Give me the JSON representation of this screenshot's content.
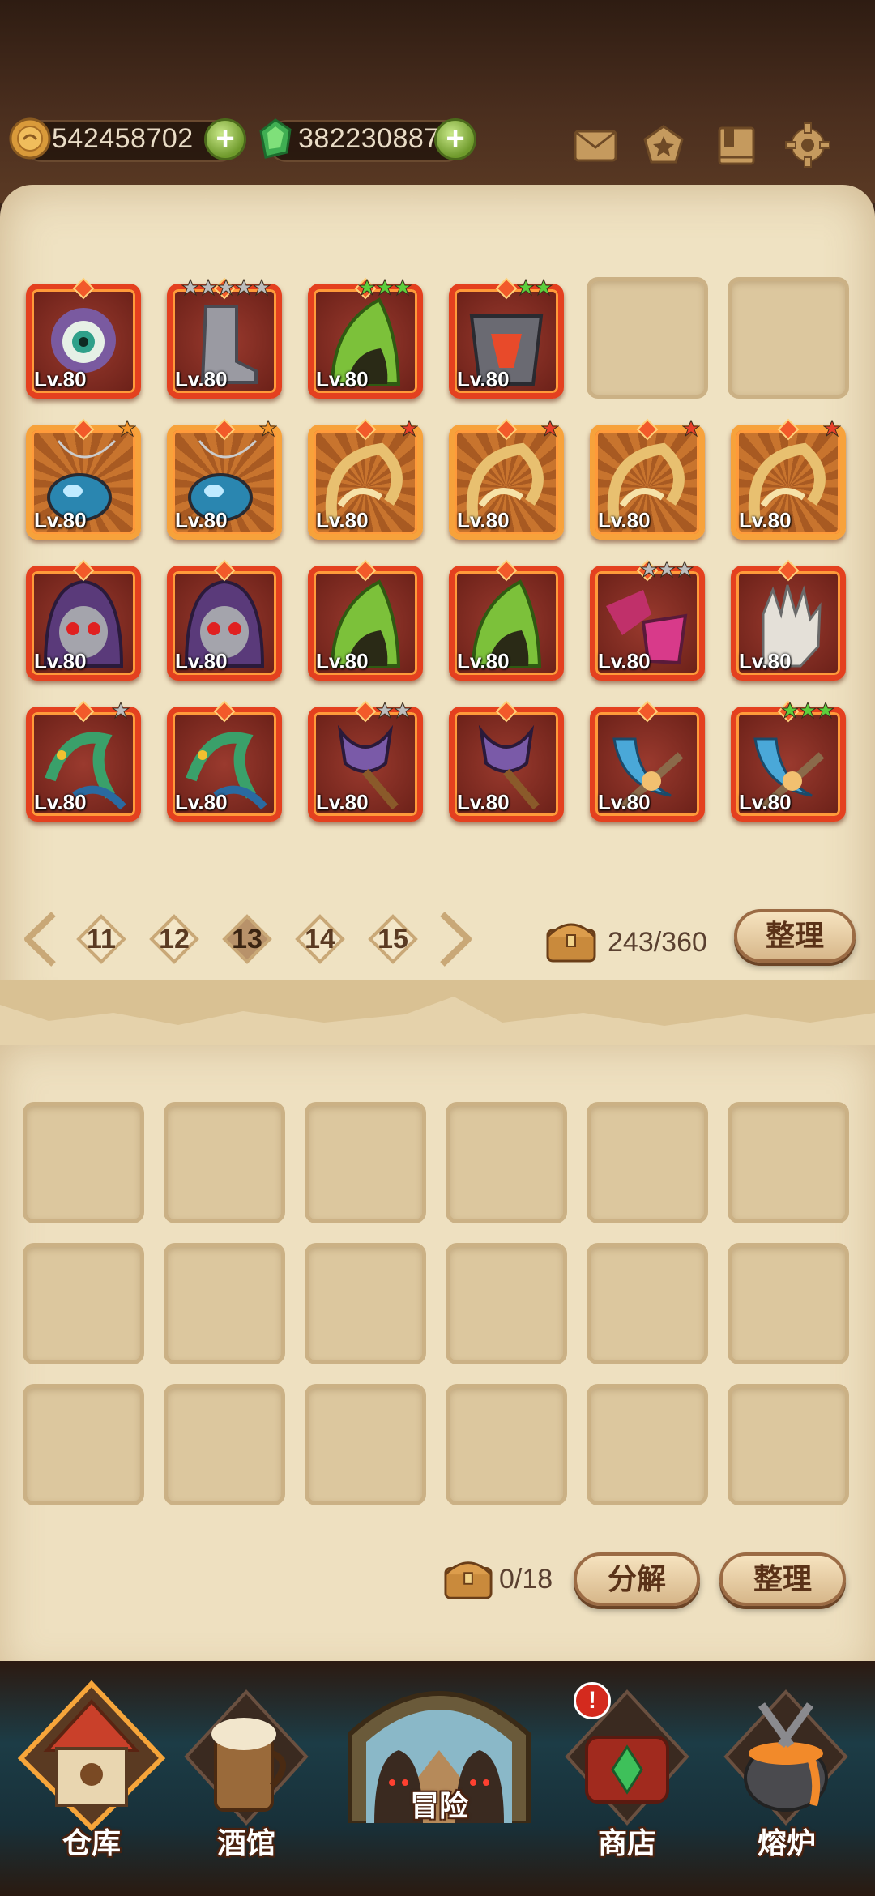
{
  "resources": {
    "gold": "542458702",
    "gems": "382230887"
  },
  "colors": {
    "wood_dark": "#2e1c12",
    "parchment": "#efe2c2",
    "item_frame_red": "#e4401f",
    "item_frame_orange": "#f7a23b",
    "plus_green": "#6f9a2c",
    "button_text": "#5a3218"
  },
  "top_icons": [
    "mail-icon",
    "favorites-icon",
    "collection-book-icon",
    "settings-gear-icon"
  ],
  "inventory": {
    "rows": [
      [
        {
          "icon": "eyeball-hood-helmet-icon",
          "level": "Lv.80",
          "stars": 0,
          "star_color": "",
          "frame": "red"
        },
        {
          "icon": "iron-boots-icon",
          "level": "Lv.80",
          "stars": 5,
          "star_color": "gray",
          "frame": "red"
        },
        {
          "icon": "green-hood-icon",
          "level": "Lv.80",
          "stars": 3,
          "star_color": "green",
          "frame": "red"
        },
        {
          "icon": "demon-armor-icon",
          "level": "Lv.80",
          "stars": 2,
          "star_color": "green",
          "frame": "red"
        },
        {
          "icon": "",
          "level": "",
          "stars": 0,
          "star_color": "",
          "frame": "empty"
        },
        {
          "icon": "",
          "level": "",
          "stars": 0,
          "star_color": "",
          "frame": "empty"
        }
      ],
      [
        {
          "icon": "blue-gem-amulet-icon",
          "level": "Lv.80",
          "stars": 1,
          "star_color": "orange",
          "frame": "orange"
        },
        {
          "icon": "blue-gem-amulet-icon",
          "level": "Lv.80",
          "stars": 1,
          "star_color": "orange",
          "frame": "orange"
        },
        {
          "icon": "horn-ring-icon",
          "level": "Lv.80",
          "stars": 1,
          "star_color": "red",
          "frame": "orange"
        },
        {
          "icon": "horn-ring-icon",
          "level": "Lv.80",
          "stars": 1,
          "star_color": "red",
          "frame": "orange"
        },
        {
          "icon": "horn-ring-icon",
          "level": "Lv.80",
          "stars": 1,
          "star_color": "red",
          "frame": "orange"
        },
        {
          "icon": "horn-ring-icon",
          "level": "Lv.80",
          "stars": 1,
          "star_color": "red",
          "frame": "orange"
        }
      ],
      [
        {
          "icon": "skull-hood-icon",
          "level": "Lv.80",
          "stars": 0,
          "star_color": "",
          "frame": "red"
        },
        {
          "icon": "skull-hood-icon",
          "level": "Lv.80",
          "stars": 0,
          "star_color": "",
          "frame": "red"
        },
        {
          "icon": "green-hood-icon",
          "level": "Lv.80",
          "stars": 0,
          "star_color": "",
          "frame": "red"
        },
        {
          "icon": "green-hood-icon",
          "level": "Lv.80",
          "stars": 0,
          "star_color": "",
          "frame": "red"
        },
        {
          "icon": "magenta-potion-gloves-icon",
          "level": "Lv.80",
          "stars": 3,
          "star_color": "gray",
          "frame": "red"
        },
        {
          "icon": "bandaged-hand-icon",
          "level": "Lv.80",
          "stars": 0,
          "star_color": "",
          "frame": "red"
        }
      ],
      [
        {
          "icon": "dragon-staff-icon",
          "level": "Lv.80",
          "stars": 1,
          "star_color": "gray",
          "frame": "red"
        },
        {
          "icon": "dragon-staff-icon",
          "level": "Lv.80",
          "stars": 0,
          "star_color": "",
          "frame": "red"
        },
        {
          "icon": "demon-scepter-icon",
          "level": "Lv.80",
          "stars": 2,
          "star_color": "gray",
          "frame": "red"
        },
        {
          "icon": "demon-scepter-icon",
          "level": "Lv.80",
          "stars": 0,
          "star_color": "",
          "frame": "red"
        },
        {
          "icon": "crescent-blade-weapon-icon",
          "level": "Lv.80",
          "stars": 0,
          "star_color": "",
          "frame": "red"
        },
        {
          "icon": "crescent-blade-weapon-icon",
          "level": "Lv.80",
          "stars": 3,
          "star_color": "green",
          "frame": "red"
        }
      ]
    ]
  },
  "pager": {
    "pages": [
      "11",
      "12",
      "13",
      "14",
      "15"
    ],
    "current": "13"
  },
  "storage": {
    "count": "243/360",
    "sort_label": "整理"
  },
  "lower": {
    "count": "0/18",
    "decompose_label": "分解",
    "sort_label": "整理"
  },
  "nav": {
    "items": [
      {
        "label": "仓库",
        "icon": "warehouse-house-icon",
        "active": true
      },
      {
        "label": "酒馆",
        "icon": "tavern-beer-mug-icon",
        "active": false
      },
      {
        "label": "冒险",
        "icon": "adventure-hooded-figures-icon",
        "active": false
      },
      {
        "label": "商店",
        "icon": "shop-chest-icon",
        "active": false
      },
      {
        "label": "熔炉",
        "icon": "furnace-cauldron-icon",
        "active": false
      }
    ],
    "shop_alert": "!"
  }
}
